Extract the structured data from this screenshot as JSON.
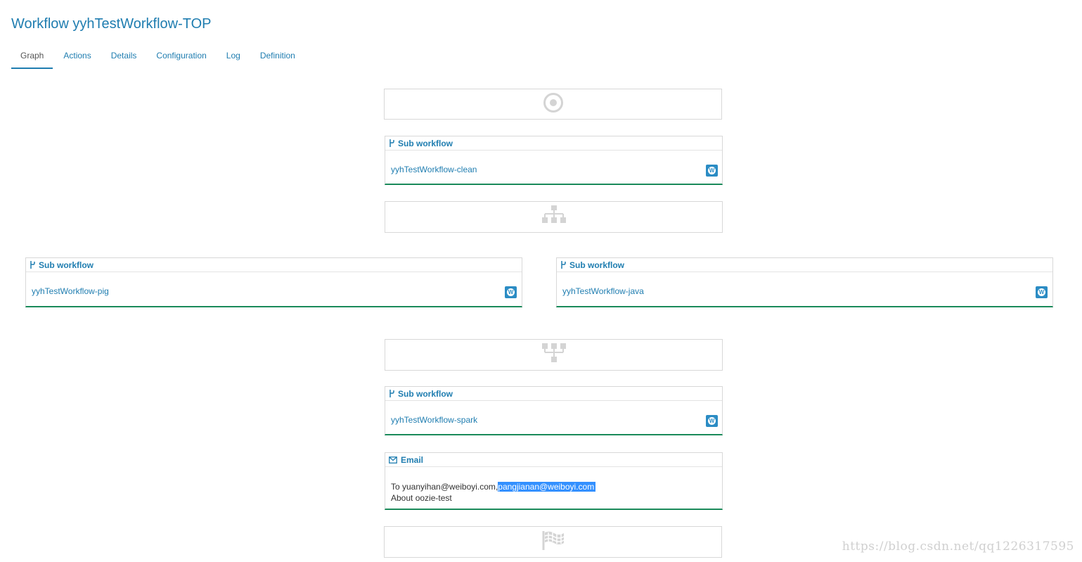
{
  "page": {
    "title": "Workflow yyhTestWorkflow-TOP"
  },
  "tabs": [
    {
      "label": "Graph",
      "active": true
    },
    {
      "label": "Actions"
    },
    {
      "label": "Details"
    },
    {
      "label": "Configuration"
    },
    {
      "label": "Log"
    },
    {
      "label": "Definition"
    }
  ],
  "graph": {
    "start": {
      "icon": "start-target-icon"
    },
    "subworkflow_clean": {
      "type_label": "Sub workflow",
      "workflow": "yyhTestWorkflow-clean",
      "badge": "W"
    },
    "fork": {
      "icon": "fork-icon"
    },
    "subworkflow_pig": {
      "type_label": "Sub workflow",
      "workflow": "yyhTestWorkflow-pig",
      "badge": "W"
    },
    "subworkflow_java": {
      "type_label": "Sub workflow",
      "workflow": "yyhTestWorkflow-java",
      "badge": "W"
    },
    "join": {
      "icon": "join-icon"
    },
    "subworkflow_spark": {
      "type_label": "Sub workflow",
      "workflow": "yyhTestWorkflow-spark",
      "badge": "W"
    },
    "email": {
      "type_label": "Email",
      "to_prefix": "To yuanyihan@weiboyi.com,",
      "to_selected": "pangjianan@weiboyi.com",
      "subject": "About oozie-test"
    },
    "end": {
      "icon": "end-flag-icon"
    }
  },
  "colors": {
    "accent": "#1f7db0",
    "success_border": "#1a8a5a",
    "badge": "#2b8cc4",
    "selection": "#3390ff"
  },
  "watermark": "https://blog.csdn.net/qq1226317595"
}
